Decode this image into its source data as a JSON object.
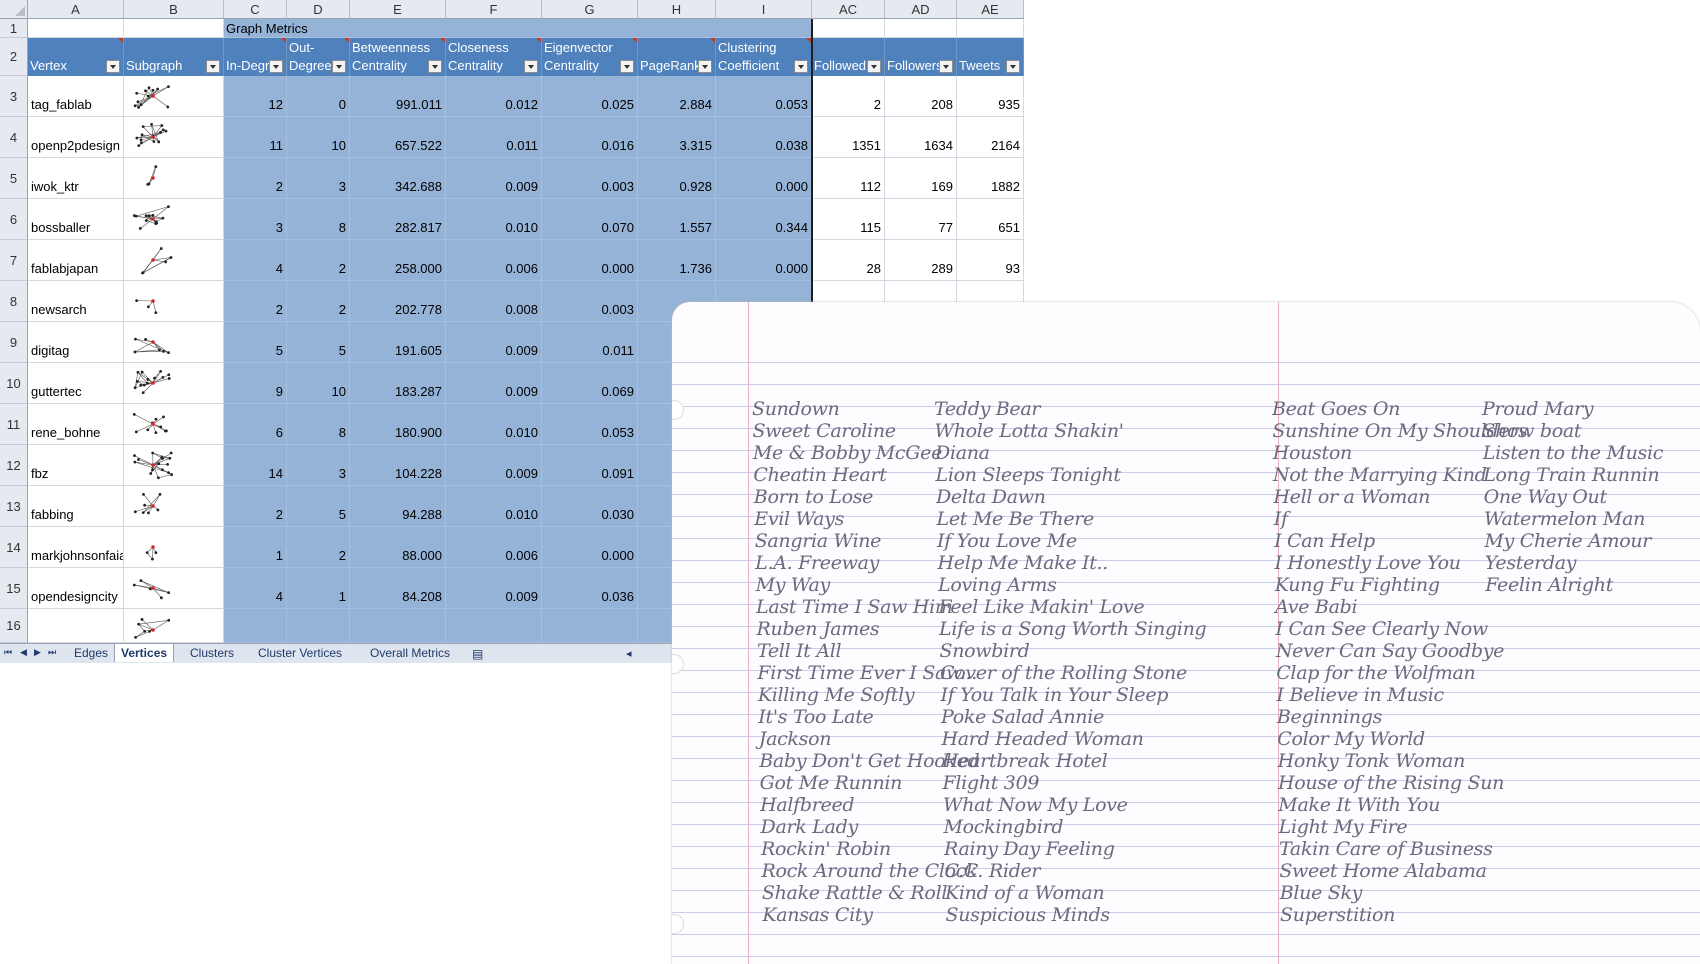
{
  "spreadsheet": {
    "column_letters": [
      "A",
      "B",
      "C",
      "D",
      "E",
      "F",
      "G",
      "H",
      "I",
      "AC",
      "AD",
      "AE"
    ],
    "group_header": "Graph Metrics",
    "headers": [
      "Vertex",
      "Subgraph",
      "In-Degr",
      "Out-\nDegree",
      "Betweenness\nCentrality",
      "Closeness\nCentrality",
      "Eigenvector\nCentrality",
      "PageRank",
      "Clustering\nCoefficient",
      "Followed",
      "Followers",
      "Tweets"
    ],
    "row_numbers": [
      "1",
      "2",
      "3",
      "4",
      "5",
      "6",
      "7",
      "8",
      "9",
      "10",
      "11",
      "12",
      "13",
      "14",
      "15",
      "16"
    ],
    "rows": [
      [
        "tag_fablab",
        "",
        "12",
        "0",
        "991.011",
        "0.012",
        "0.025",
        "2.884",
        "0.053",
        "2",
        "208",
        "935"
      ],
      [
        "openp2pdesign",
        "",
        "11",
        "10",
        "657.522",
        "0.011",
        "0.016",
        "3.315",
        "0.038",
        "1351",
        "1634",
        "2164"
      ],
      [
        "iwok_ktr",
        "",
        "2",
        "3",
        "342.688",
        "0.009",
        "0.003",
        "0.928",
        "0.000",
        "112",
        "169",
        "1882"
      ],
      [
        "bossballer",
        "",
        "3",
        "8",
        "282.817",
        "0.010",
        "0.070",
        "1.557",
        "0.344",
        "115",
        "77",
        "651"
      ],
      [
        "fablabjapan",
        "",
        "4",
        "2",
        "258.000",
        "0.006",
        "0.000",
        "1.736",
        "0.000",
        "28",
        "289",
        "93"
      ],
      [
        "newsarch",
        "",
        "2",
        "2",
        "202.778",
        "0.008",
        "0.003",
        "",
        "",
        "",
        "",
        ""
      ],
      [
        "digitag",
        "",
        "5",
        "5",
        "191.605",
        "0.009",
        "0.011",
        "",
        "",
        "",
        "",
        ""
      ],
      [
        "guttertec",
        "",
        "9",
        "10",
        "183.287",
        "0.009",
        "0.069",
        "",
        "",
        "",
        "",
        ""
      ],
      [
        "rene_bohne",
        "",
        "6",
        "8",
        "180.900",
        "0.010",
        "0.053",
        "",
        "",
        "",
        "",
        ""
      ],
      [
        "fbz",
        "",
        "14",
        "3",
        "104.228",
        "0.009",
        "0.091",
        "",
        "",
        "",
        "",
        ""
      ],
      [
        "fabbing",
        "",
        "2",
        "5",
        "94.288",
        "0.010",
        "0.030",
        "",
        "",
        "",
        "",
        ""
      ],
      [
        "markjohnsonfaia",
        "",
        "1",
        "2",
        "88.000",
        "0.006",
        "0.000",
        "",
        "",
        "",
        "",
        ""
      ],
      [
        "opendesigncity",
        "",
        "4",
        "1",
        "84.208",
        "0.009",
        "0.036",
        "",
        "",
        "",
        "",
        ""
      ]
    ],
    "tabs": [
      "Edges",
      "Vertices",
      "Clusters",
      "Cluster Vertices",
      "Overall Metrics"
    ],
    "active_tab": "Vertices",
    "colors": {
      "header_blue": "#4f81bd",
      "cell_blue": "#95b3d7"
    }
  },
  "paper": {
    "columns": [
      [
        "Sundown",
        "Sweet Caroline",
        "Me & Bobby McGee",
        "Cheatin Heart",
        "Born to Lose",
        "Evil Ways",
        "Sangria Wine",
        "L.A. Freeway",
        "My Way",
        "Last Time I Saw Him",
        "Ruben James",
        "Tell It All",
        "First Time Ever I Saw...",
        "Killing Me Softly",
        "It's Too Late",
        "Jackson",
        "Baby Don't Get Hooked",
        "Got Me Runnin",
        "Halfbreed",
        "Dark Lady",
        "Rockin' Robin",
        "Rock Around the Clock",
        "Shake Rattle & Roll",
        "Kansas City"
      ],
      [
        "Teddy Bear",
        "Whole Lotta Shakin'",
        "Diana",
        "Lion Sleeps Tonight",
        "Delta Dawn",
        "Let Me Be There",
        "If You Love Me",
        "Help Me Make It..",
        "Loving Arms",
        "Feel Like Makin' Love",
        "Life is a Song Worth Singing",
        "Snowbird",
        "Cover of the Rolling Stone",
        "If You Talk in Your Sleep",
        "Poke Salad Annie",
        "Hard Headed Woman",
        "Heartbreak Hotel",
        "Flight 309",
        "What Now My Love",
        "Mockingbird",
        "Rainy Day Feeling",
        "C.C. Rider",
        "Kind of a Woman",
        "Suspicious Minds"
      ],
      [
        "Beat Goes On",
        "Sunshine On My Shoulders",
        "Houston",
        "Not the Marrying Kind",
        "Hell or a Woman",
        "If",
        "I Can Help",
        "I Honestly Love You",
        "Kung Fu Fighting",
        "Ave Babi",
        "I Can See Clearly Now",
        "Never Can Say Goodbye",
        "Clap for the Wolfman",
        "I Believe in Music",
        "Beginnings",
        "Color My World",
        "Honky Tonk Woman",
        "House of the Rising Sun",
        "Make It With You",
        "Light My Fire",
        "Takin Care of Business",
        "Sweet Home Alabama",
        "Blue Sky",
        "Superstition"
      ],
      [
        "Proud Mary",
        "Show boat",
        "Listen to the Music",
        "Long Train Runnin",
        "One Way Out",
        "Watermelon Man",
        "My Cherie Amour",
        "Yesterday",
        "Feelin Alright"
      ]
    ]
  }
}
